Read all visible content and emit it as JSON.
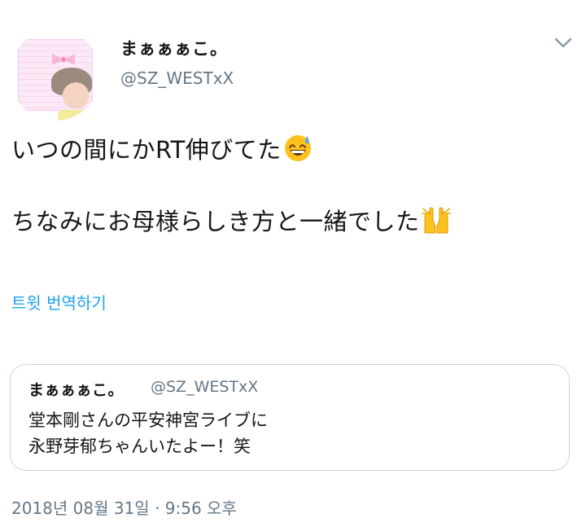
{
  "tweet": {
    "author_name": "まぁぁぁこ。",
    "author_handle": "@SZ_WESTxX",
    "text_line1": "いつの間にかRT伸びてた",
    "text_line2": "ちなみにお母様らしき方と一緒でした",
    "emoji1": "grinning-face-with-sweat",
    "emoji2": "raising-hands",
    "translate_label": "트윗 번역하기",
    "timestamp": "2018년 08월 31일 · 9:56 오후"
  },
  "quoted_tweet": {
    "author_name": "まぁぁぁこ。",
    "author_handle": "@SZ_WESTxX",
    "text_line1": "堂本剛さんの平安神宮ライブに",
    "text_line2": "永野芽郁ちゃんいたよー！笑"
  },
  "colors": {
    "link": "#1da1f2",
    "secondary_text": "#657786",
    "border": "#ccd6dd"
  }
}
